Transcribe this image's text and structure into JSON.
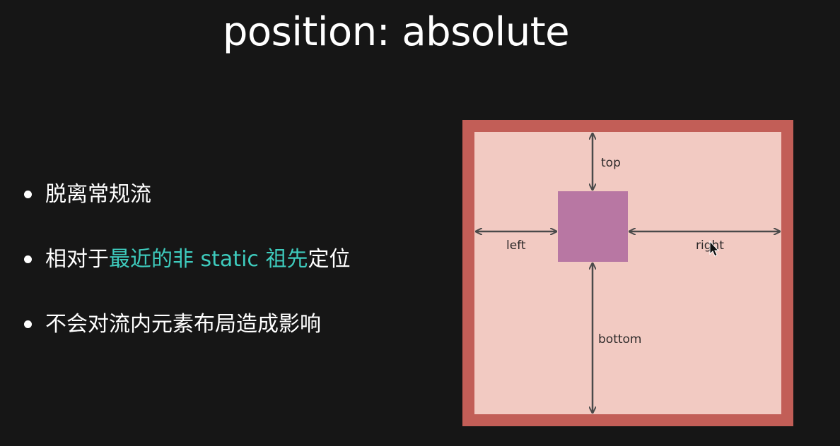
{
  "title": "position: absolute",
  "bullets": {
    "item1": "脱离常规流",
    "item2_prefix": "相对于",
    "item2_highlight": "最近的非 static 祖先",
    "item2_suffix": "定位",
    "item3": "不会对流内元素布局造成影响"
  },
  "diagram": {
    "labels": {
      "top": "top",
      "left": "left",
      "right": "right",
      "bottom": "bottom"
    },
    "colors": {
      "outer_border": "#c25e57",
      "container_fill": "#f2cac2",
      "box_fill": "#b877a3",
      "arrow": "#4a4a4a"
    }
  },
  "colors": {
    "background": "#161616",
    "text": "#ffffff",
    "highlight": "#3ecbbd"
  }
}
